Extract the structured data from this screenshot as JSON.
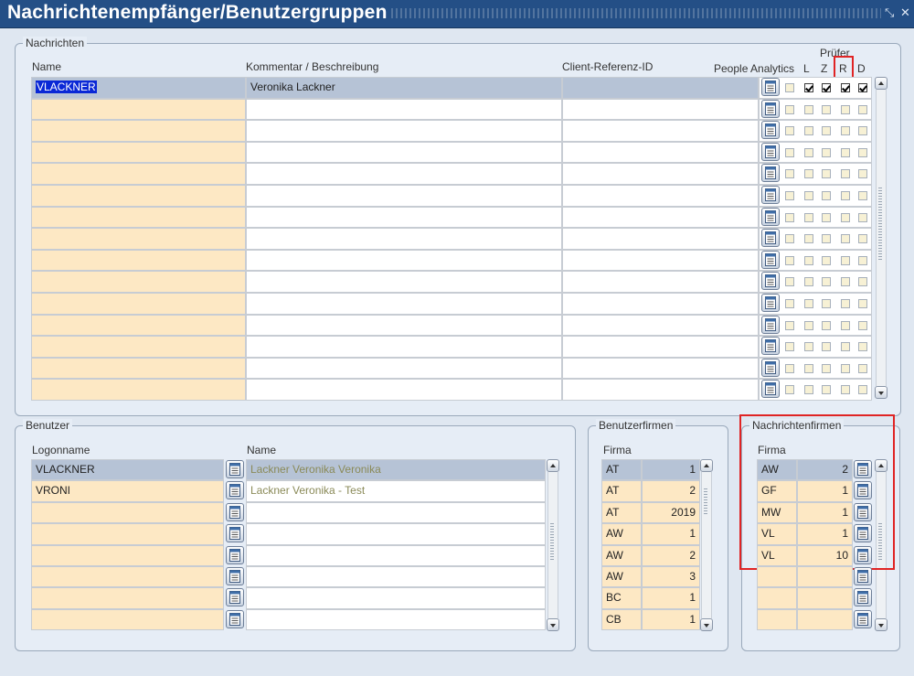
{
  "window": {
    "title": "Nachrichtenempfänger/Benutzergruppen",
    "minimize_icon": "restore-icon",
    "close_icon": "close-icon"
  },
  "nachrichten": {
    "label": "Nachrichten",
    "headers": {
      "name": "Name",
      "kommentar": "Kommentar / Beschreibung",
      "client": "Client-Referenz-ID",
      "people": "People Analytics",
      "pruefer": "Prüfer",
      "l": "L",
      "z": "Z",
      "r": "R",
      "d": "D"
    },
    "rows": [
      {
        "name": "VLACKNER",
        "kommentar": "Veronika Lackner",
        "client": "",
        "people": false,
        "l": true,
        "z": true,
        "r": true,
        "d": true
      }
    ],
    "empty_rows": 14
  },
  "benutzer": {
    "label": "Benutzer",
    "headers": {
      "logon": "Logonname",
      "name": "Name"
    },
    "rows": [
      {
        "logon": "VLACKNER",
        "name": "Lackner Veronika Veronika"
      },
      {
        "logon": "VRONI",
        "name": "Lackner Veronika - Test"
      }
    ],
    "empty_rows": 6
  },
  "benutzerfirmen": {
    "label": "Benutzerfirmen",
    "header": "Firma",
    "rows": [
      {
        "firma": "AT",
        "nr": "1"
      },
      {
        "firma": "AT",
        "nr": "2"
      },
      {
        "firma": "AT",
        "nr": "2019"
      },
      {
        "firma": "AW",
        "nr": "1"
      },
      {
        "firma": "AW",
        "nr": "2"
      },
      {
        "firma": "AW",
        "nr": "3"
      },
      {
        "firma": "BC",
        "nr": "1"
      },
      {
        "firma": "CB",
        "nr": "1"
      }
    ]
  },
  "nachrichtenfirmen": {
    "label": "Nachrichtenfirmen",
    "header": "Firma",
    "rows": [
      {
        "firma": "AW",
        "nr": "2"
      },
      {
        "firma": "GF",
        "nr": "1"
      },
      {
        "firma": "MW",
        "nr": "1"
      },
      {
        "firma": "VL",
        "nr": "1"
      },
      {
        "firma": "VL",
        "nr": "10"
      }
    ],
    "empty_rows": 3
  },
  "colors": {
    "titlebar": "#244f86",
    "background": "#dfe7f1",
    "field_peach": "#fde8c4",
    "selected_row": "#b6c3d6",
    "highlight_box": "#e02424"
  }
}
